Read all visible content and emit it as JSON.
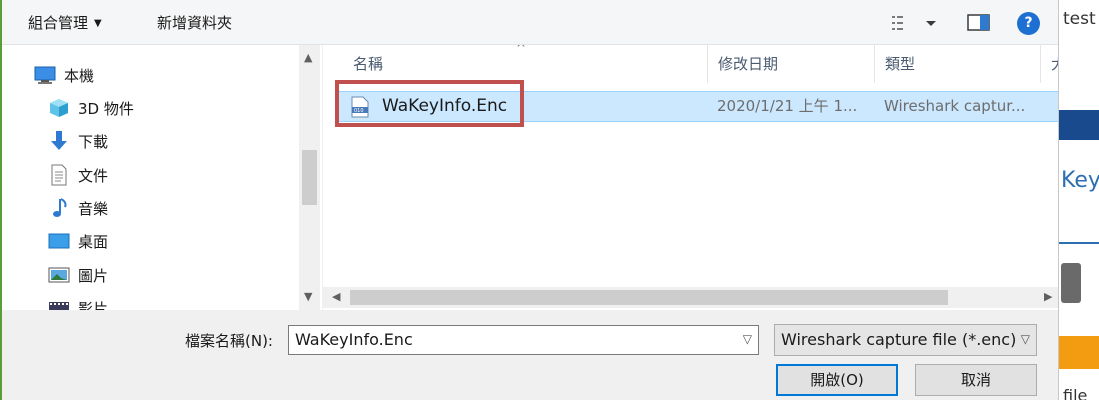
{
  "toolbar": {
    "organize_label": "組合管理",
    "new_folder_label": "新增資料夾"
  },
  "nav": {
    "items": [
      {
        "label": "本機",
        "icon": "computer-icon"
      },
      {
        "label": "3D 物件",
        "icon": "cube-3d-icon"
      },
      {
        "label": "下載",
        "icon": "download-arrow-icon"
      },
      {
        "label": "文件",
        "icon": "document-icon"
      },
      {
        "label": "音樂",
        "icon": "music-note-icon"
      },
      {
        "label": "桌面",
        "icon": "desktop-icon"
      },
      {
        "label": "圖片",
        "icon": "pictures-icon"
      },
      {
        "label": "影片",
        "icon": "video-icon"
      }
    ]
  },
  "list": {
    "columns": {
      "name": "名稱",
      "date": "修改日期",
      "type": "類型",
      "size": "大"
    },
    "files": [
      {
        "name": "WaKeyInfo.Enc",
        "date": "2020/1/21 上午 1...",
        "type": "Wireshark captur..."
      }
    ]
  },
  "bottom": {
    "filename_label": "檔案名稱(N):",
    "filename_value": "WaKeyInfo.Enc",
    "filter_value": "Wireshark capture file (*.enc)",
    "open_label": "開啟(O)",
    "cancel_label": "取消"
  },
  "background_page": {
    "top_text": "test",
    "mid_text": "Key",
    "bottom_text": "file"
  },
  "colors": {
    "selection": "#cce8ff",
    "highlight_box": "#c0504d",
    "help_icon": "#1e6fd2",
    "primary_button_border": "#0078d7"
  }
}
